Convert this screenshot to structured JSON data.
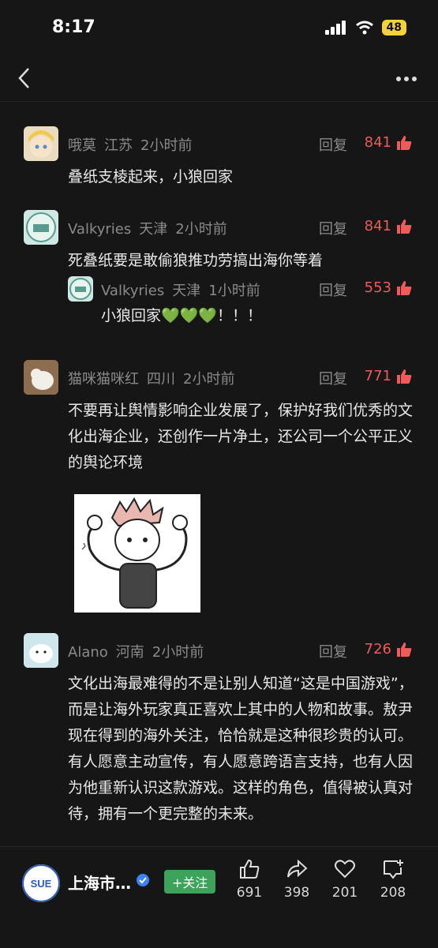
{
  "status": {
    "time": "8:17",
    "battery": "48"
  },
  "comments": [
    {
      "user": "哦莫",
      "location": "江苏",
      "time": "2小时前",
      "reply": "回复",
      "likes": "841",
      "text": "叠纸支棱起来，小狼回家"
    },
    {
      "user": "Valkyries",
      "location": "天津",
      "time": "2小时前",
      "reply": "回复",
      "likes": "841",
      "text": "死叠纸要是敢偷狼推功劳搞出海你等着"
    },
    {
      "user": "Valkyries",
      "location": "天津",
      "time": "1小时前",
      "reply": "回复",
      "likes": "553",
      "text": "小狼回家💚💚💚！！！"
    },
    {
      "user": "猫咪猫咪红",
      "location": "四川",
      "time": "2小时前",
      "reply": "回复",
      "likes": "771",
      "text": "不要再让舆情影响企业发展了，保护好我们优秀的文化出海企业，还创作一片净土，还公司一个公平正义的舆论环境"
    },
    {
      "user": "Alano",
      "location": "河南",
      "time": "2小时前",
      "reply": "回复",
      "likes": "726",
      "text": "文化出海最难得的不是让别人知道“这是中国游戏”，而是让海外玩家真正喜欢上其中的人物和故事。敖尹现在得到的海外关注，恰恰就是这种很珍贵的认可。有人愿意主动宣传，有人愿意跨语言支持，也有人因为他重新认识这款游戏。这样的角色，值得被认真对待，拥有一个更完整的未来。"
    }
  ],
  "bottom": {
    "publisher": "上海市…",
    "logo_text": "SUE",
    "follow": "+关注",
    "like_count": "691",
    "share_count": "398",
    "fav_count": "201",
    "comment_count": "208"
  }
}
